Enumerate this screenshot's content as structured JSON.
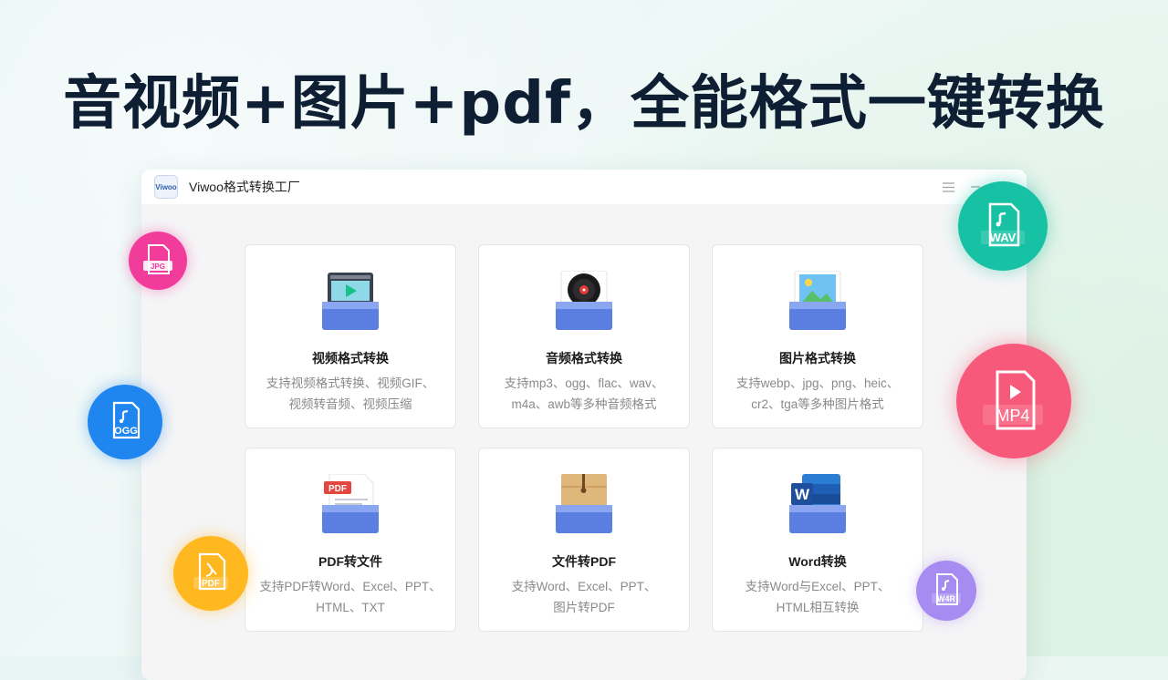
{
  "headline": "音视频+图片+pdf，全能格式一键转换",
  "window": {
    "title": "Viwoo格式转换工厂",
    "logo_text": "Viwoo"
  },
  "cards": [
    {
      "title": "视频格式转换",
      "desc1": "支持视频格式转换、视频GIF、",
      "desc2": "视频转音频、视频压缩",
      "icon": "video-file-icon"
    },
    {
      "title": "音频格式转换",
      "desc1": "支持mp3、ogg、flac、wav、",
      "desc2": "m4a、awb等多种音频格式",
      "icon": "audio-record-icon"
    },
    {
      "title": "图片格式转换",
      "desc1": "支持webp、jpg、png、heic、",
      "desc2": "cr2、tga等多种图片格式",
      "icon": "image-file-icon"
    },
    {
      "title": "PDF转文件",
      "desc1": "支持PDF转Word、Excel、PPT、",
      "desc2": "HTML、TXT",
      "icon": "pdf-file-icon",
      "icon_label": "PDF"
    },
    {
      "title": "文件转PDF",
      "desc1": "支持Word、Excel、PPT、",
      "desc2": "图片转PDF",
      "icon": "envelope-file-icon"
    },
    {
      "title": "Word转换",
      "desc1": "支持Word与Excel、PPT、",
      "desc2": "HTML相互转换",
      "icon": "word-file-icon",
      "icon_label": "W"
    }
  ],
  "badges": [
    {
      "label": "JPG",
      "color": "#f23c9c",
      "icon": "jpg-file-badge-icon"
    },
    {
      "label": "WAV",
      "color": "#17c2a4",
      "icon": "wav-file-badge-icon"
    },
    {
      "label": "OGG",
      "color": "#1f86f0",
      "icon": "ogg-file-badge-icon"
    },
    {
      "label": "MP4",
      "color": "#f7597a",
      "icon": "mp4-file-badge-icon"
    },
    {
      "label": "PDF",
      "color": "#ffb81f",
      "icon": "pdf-file-badge-icon"
    },
    {
      "label": "W4R",
      "color": "#a68cf0",
      "icon": "w4r-file-badge-icon"
    }
  ],
  "colors": {
    "tray_blue": "#5b7fe0",
    "headline": "#0f1f33"
  }
}
